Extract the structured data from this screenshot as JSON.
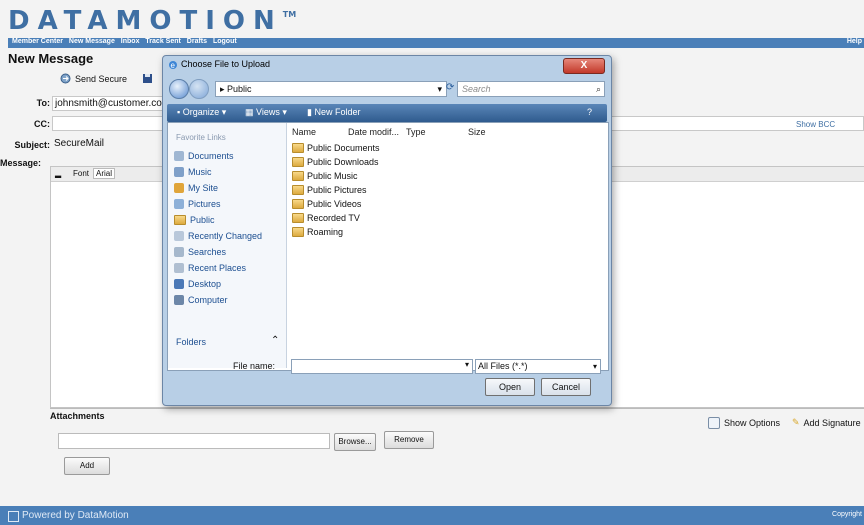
{
  "brand": {
    "logo_text": "DATAMOTION",
    "tm": "TM"
  },
  "nav": {
    "links": [
      "Member Center",
      "New Message",
      "Inbox",
      "Track Sent",
      "Drafts",
      "Logout"
    ],
    "help": "Help"
  },
  "compose": {
    "title": "New Message",
    "send_label": "Send Secure",
    "to_label": "To:",
    "to_value": "johnsmith@customer.com",
    "cc_label": "CC:",
    "cc_value": "",
    "show_bcc": "Show BCC",
    "subject_label": "Subject:",
    "subject_value": "SecureMail",
    "message_label": "Message:",
    "font_label": "Font",
    "font_value": "Arial"
  },
  "attachments": {
    "title": "Attachments",
    "browse": "Browse...",
    "remove": "Remove",
    "add": "Add",
    "show_options": "Show Options",
    "add_signature": "Add Signature"
  },
  "footer": {
    "powered": "Powered by DataMotion",
    "copyright": "Copyright"
  },
  "dialog": {
    "title": "Choose File to Upload",
    "close": "X",
    "path": "Public",
    "search_placeholder": "Search",
    "toolbar": {
      "organize": "Organize",
      "views": "Views",
      "new_folder": "New Folder"
    },
    "favorites_header": "Favorite Links",
    "favorites": [
      "Documents",
      "Music",
      "My Site",
      "Pictures",
      "Public",
      "Recently Changed",
      "Searches",
      "Recent Places",
      "Desktop",
      "Computer"
    ],
    "folders_label": "Folders",
    "columns": [
      "Name",
      "Date modif...",
      "Type",
      "Size"
    ],
    "files": [
      "Public Documents",
      "Public Downloads",
      "Public Music",
      "Public Pictures",
      "Public Videos",
      "Recorded TV",
      "Roaming"
    ],
    "file_name_label": "File name:",
    "file_name_value": "",
    "file_type": "All Files (*.*)",
    "open": "Open",
    "cancel": "Cancel"
  }
}
